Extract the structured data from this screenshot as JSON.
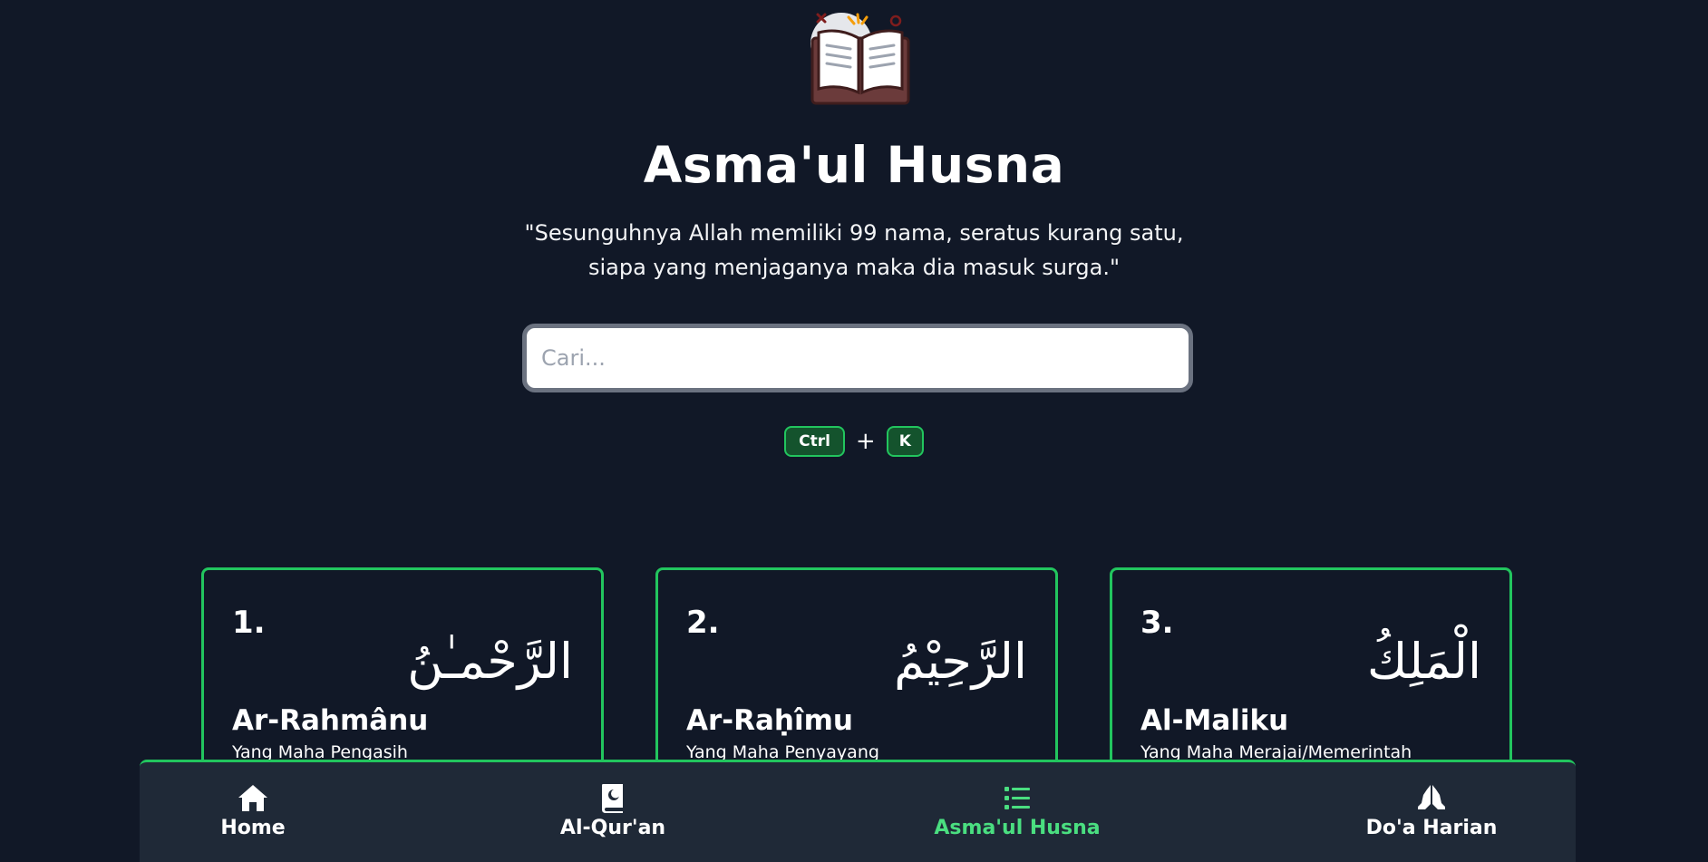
{
  "header": {
    "title": "Asma'ul Husna",
    "quote_line1": "\"Sesunguhnya Allah memiliki 99 nama, seratus kurang satu,",
    "quote_line2": "siapa yang menjaganya maka dia masuk surga.\""
  },
  "search": {
    "placeholder": "Cari...",
    "value": ""
  },
  "shortcut": {
    "key1": "Ctrl",
    "plus": "+",
    "key2": "K"
  },
  "cards": [
    {
      "number": "1.",
      "arabic": "الرَّحْمـٰنُ",
      "latin": "Ar-Rahmânu",
      "meaning": "Yang Maha Pengasih"
    },
    {
      "number": "2.",
      "arabic": "الرَّحِيْمُ",
      "latin": "Ar-Raḥîmu",
      "meaning": "Yang Maha Penyayang"
    },
    {
      "number": "3.",
      "arabic": "الْمَلِكُ",
      "latin": "Al-Maliku",
      "meaning": "Yang Maha Merajai/Memerintah"
    }
  ],
  "nav": {
    "items": [
      {
        "label": "Home",
        "icon": "home-icon"
      },
      {
        "label": "Al-Qur'an",
        "icon": "quran-icon"
      },
      {
        "label": "Asma'ul Husna",
        "icon": "list-icon",
        "active": true
      },
      {
        "label": "Do'a Harian",
        "icon": "praying-hands-icon"
      }
    ]
  },
  "colors": {
    "background": "#111827",
    "accent": "#22c55e",
    "active_nav": "#4ade80",
    "nav_background": "#1f2937",
    "kbd_background": "#14532d"
  }
}
